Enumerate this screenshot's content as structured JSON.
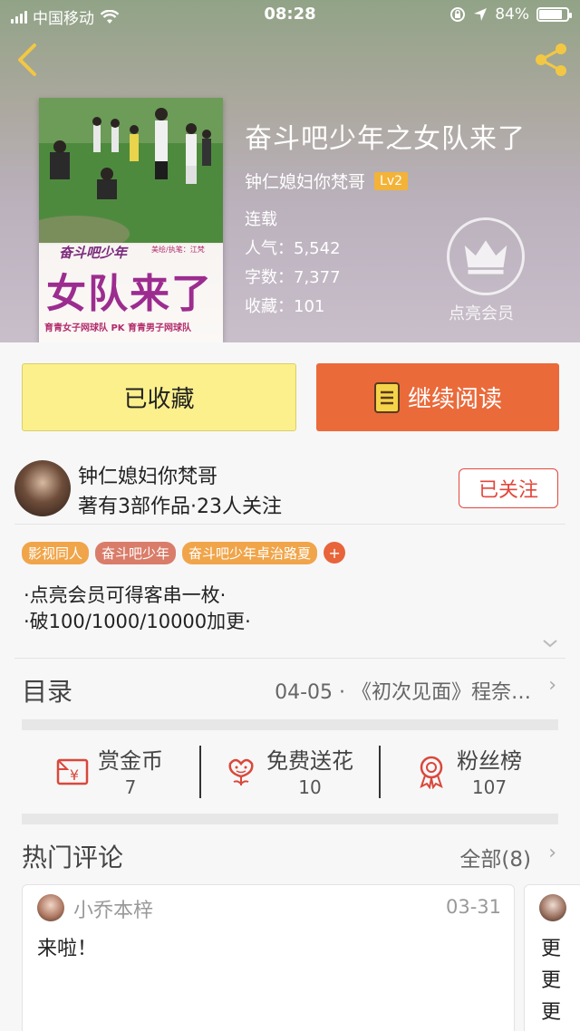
{
  "status_bar": {
    "carrier": "中国移动",
    "time": "08:28",
    "battery": "84%"
  },
  "book": {
    "title": "奋斗吧少年之女队来了",
    "author": "钟仁媳妇你梵哥",
    "level": "Lv2",
    "status": "连载",
    "popularity_label": "人气：",
    "popularity": "5,542",
    "words_label": "字数：",
    "words": "7,377",
    "favorites_label": "收藏：",
    "favorites": "101",
    "vip_label": "点亮会员"
  },
  "cover": {
    "title_line1": "奋斗吧少年",
    "title_line2": "女队来了",
    "credit": "美绘/执笔：江梵",
    "bottom_text": "育青女子网球队 PK 育青男子网球队"
  },
  "buttons": {
    "favorite": "已收藏",
    "continue_reading": "继续阅读"
  },
  "author_block": {
    "name": "钟仁媳妇你梵哥",
    "meta": "著有3部作品·23人关注",
    "follow": "已关注"
  },
  "tags": [
    "影视同人",
    "奋斗吧少年",
    "奋斗吧少年卓治路夏",
    "+"
  ],
  "description": {
    "line1": "·点亮会员可得客串一枚·",
    "line2": "·破100/1000/10000加更·"
  },
  "toc": {
    "label": "目录",
    "latest": "04-05 · 《初次见面》程奈…"
  },
  "actions": [
    {
      "label": "赏金币",
      "count": "7"
    },
    {
      "label": "免费送花",
      "count": "10"
    },
    {
      "label": "粉丝榜",
      "count": "107"
    }
  ],
  "hot_comments": {
    "label": "热门评论",
    "all": "全部(8)",
    "items": [
      {
        "user": "小乔本梓",
        "date": "03-31",
        "text": "来啦！"
      }
    ],
    "second_preview": [
      "更",
      "更",
      "更"
    ]
  },
  "colors": {
    "accent_orange": "#ea6a3a",
    "favorite_yellow": "#fbf08c",
    "follow_red": "#e2473d",
    "level_badge": "#f3b338"
  }
}
